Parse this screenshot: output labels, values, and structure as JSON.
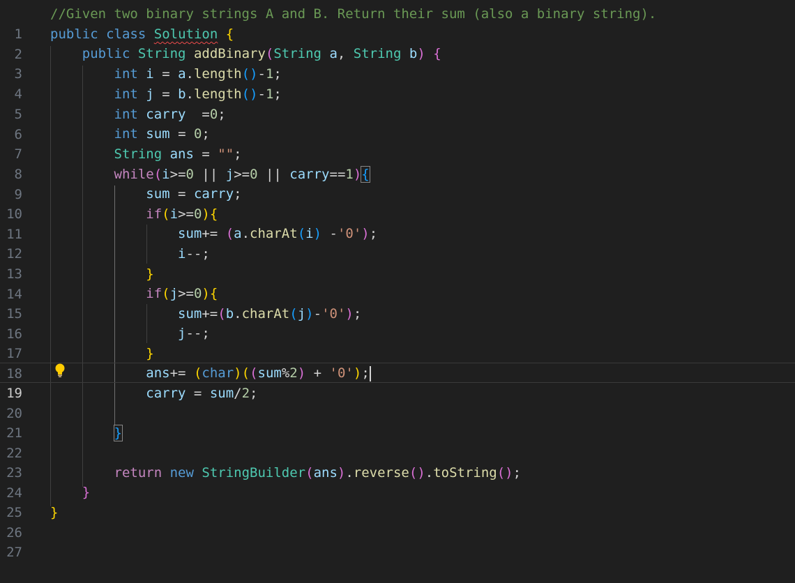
{
  "editor": {
    "language": "java",
    "active_line": 19,
    "lines": [
      {
        "num": "1"
      },
      {
        "num": "2"
      },
      {
        "num": "3"
      },
      {
        "num": "4"
      },
      {
        "num": "5"
      },
      {
        "num": "6"
      },
      {
        "num": "7"
      },
      {
        "num": "8"
      },
      {
        "num": "9"
      },
      {
        "num": "10"
      },
      {
        "num": "11"
      },
      {
        "num": "12"
      },
      {
        "num": "13"
      },
      {
        "num": "14"
      },
      {
        "num": "15"
      },
      {
        "num": "16"
      },
      {
        "num": "17"
      },
      {
        "num": "18"
      },
      {
        "num": "19"
      },
      {
        "num": "20"
      },
      {
        "num": "21"
      },
      {
        "num": "22"
      },
      {
        "num": "23"
      },
      {
        "num": "24"
      },
      {
        "num": "25"
      },
      {
        "num": "26"
      },
      {
        "num": "27"
      }
    ],
    "tokens": {
      "comment": "//Given two binary strings A and B. Return their sum (also a binary string).",
      "public": "public",
      "class": "class",
      "solution": "Solution",
      "String": "String",
      "addBinary": "addBinary",
      "a": "a",
      "b": "b",
      "int": "int",
      "i": "i",
      "j": "j",
      "length": "length",
      "carry": "carry",
      "sum": "sum",
      "ans": "ans",
      "while": "while",
      "if": "if",
      "charAt": "charAt",
      "char": "char",
      "return": "return",
      "new": "new",
      "StringBuilder": "StringBuilder",
      "reverse": "reverse",
      "toString": "toString",
      "zero": "0",
      "one": "1",
      "two": "2",
      "charZero": "'0'",
      "emptyStr": "\"\""
    },
    "colors": {
      "background": "#1f1f1f",
      "comment": "#6a9955",
      "keyword": "#569cd6",
      "control": "#c586c0",
      "type": "#4ec9b0",
      "function": "#dcdcaa",
      "variable": "#9cdcfe",
      "number": "#b5cea8",
      "string": "#ce9178",
      "bracket_gold": "#ffd700",
      "bracket_purple": "#da70d6",
      "bracket_blue": "#179fff"
    },
    "icons": {
      "lightbulb": "lightbulb-icon"
    }
  }
}
